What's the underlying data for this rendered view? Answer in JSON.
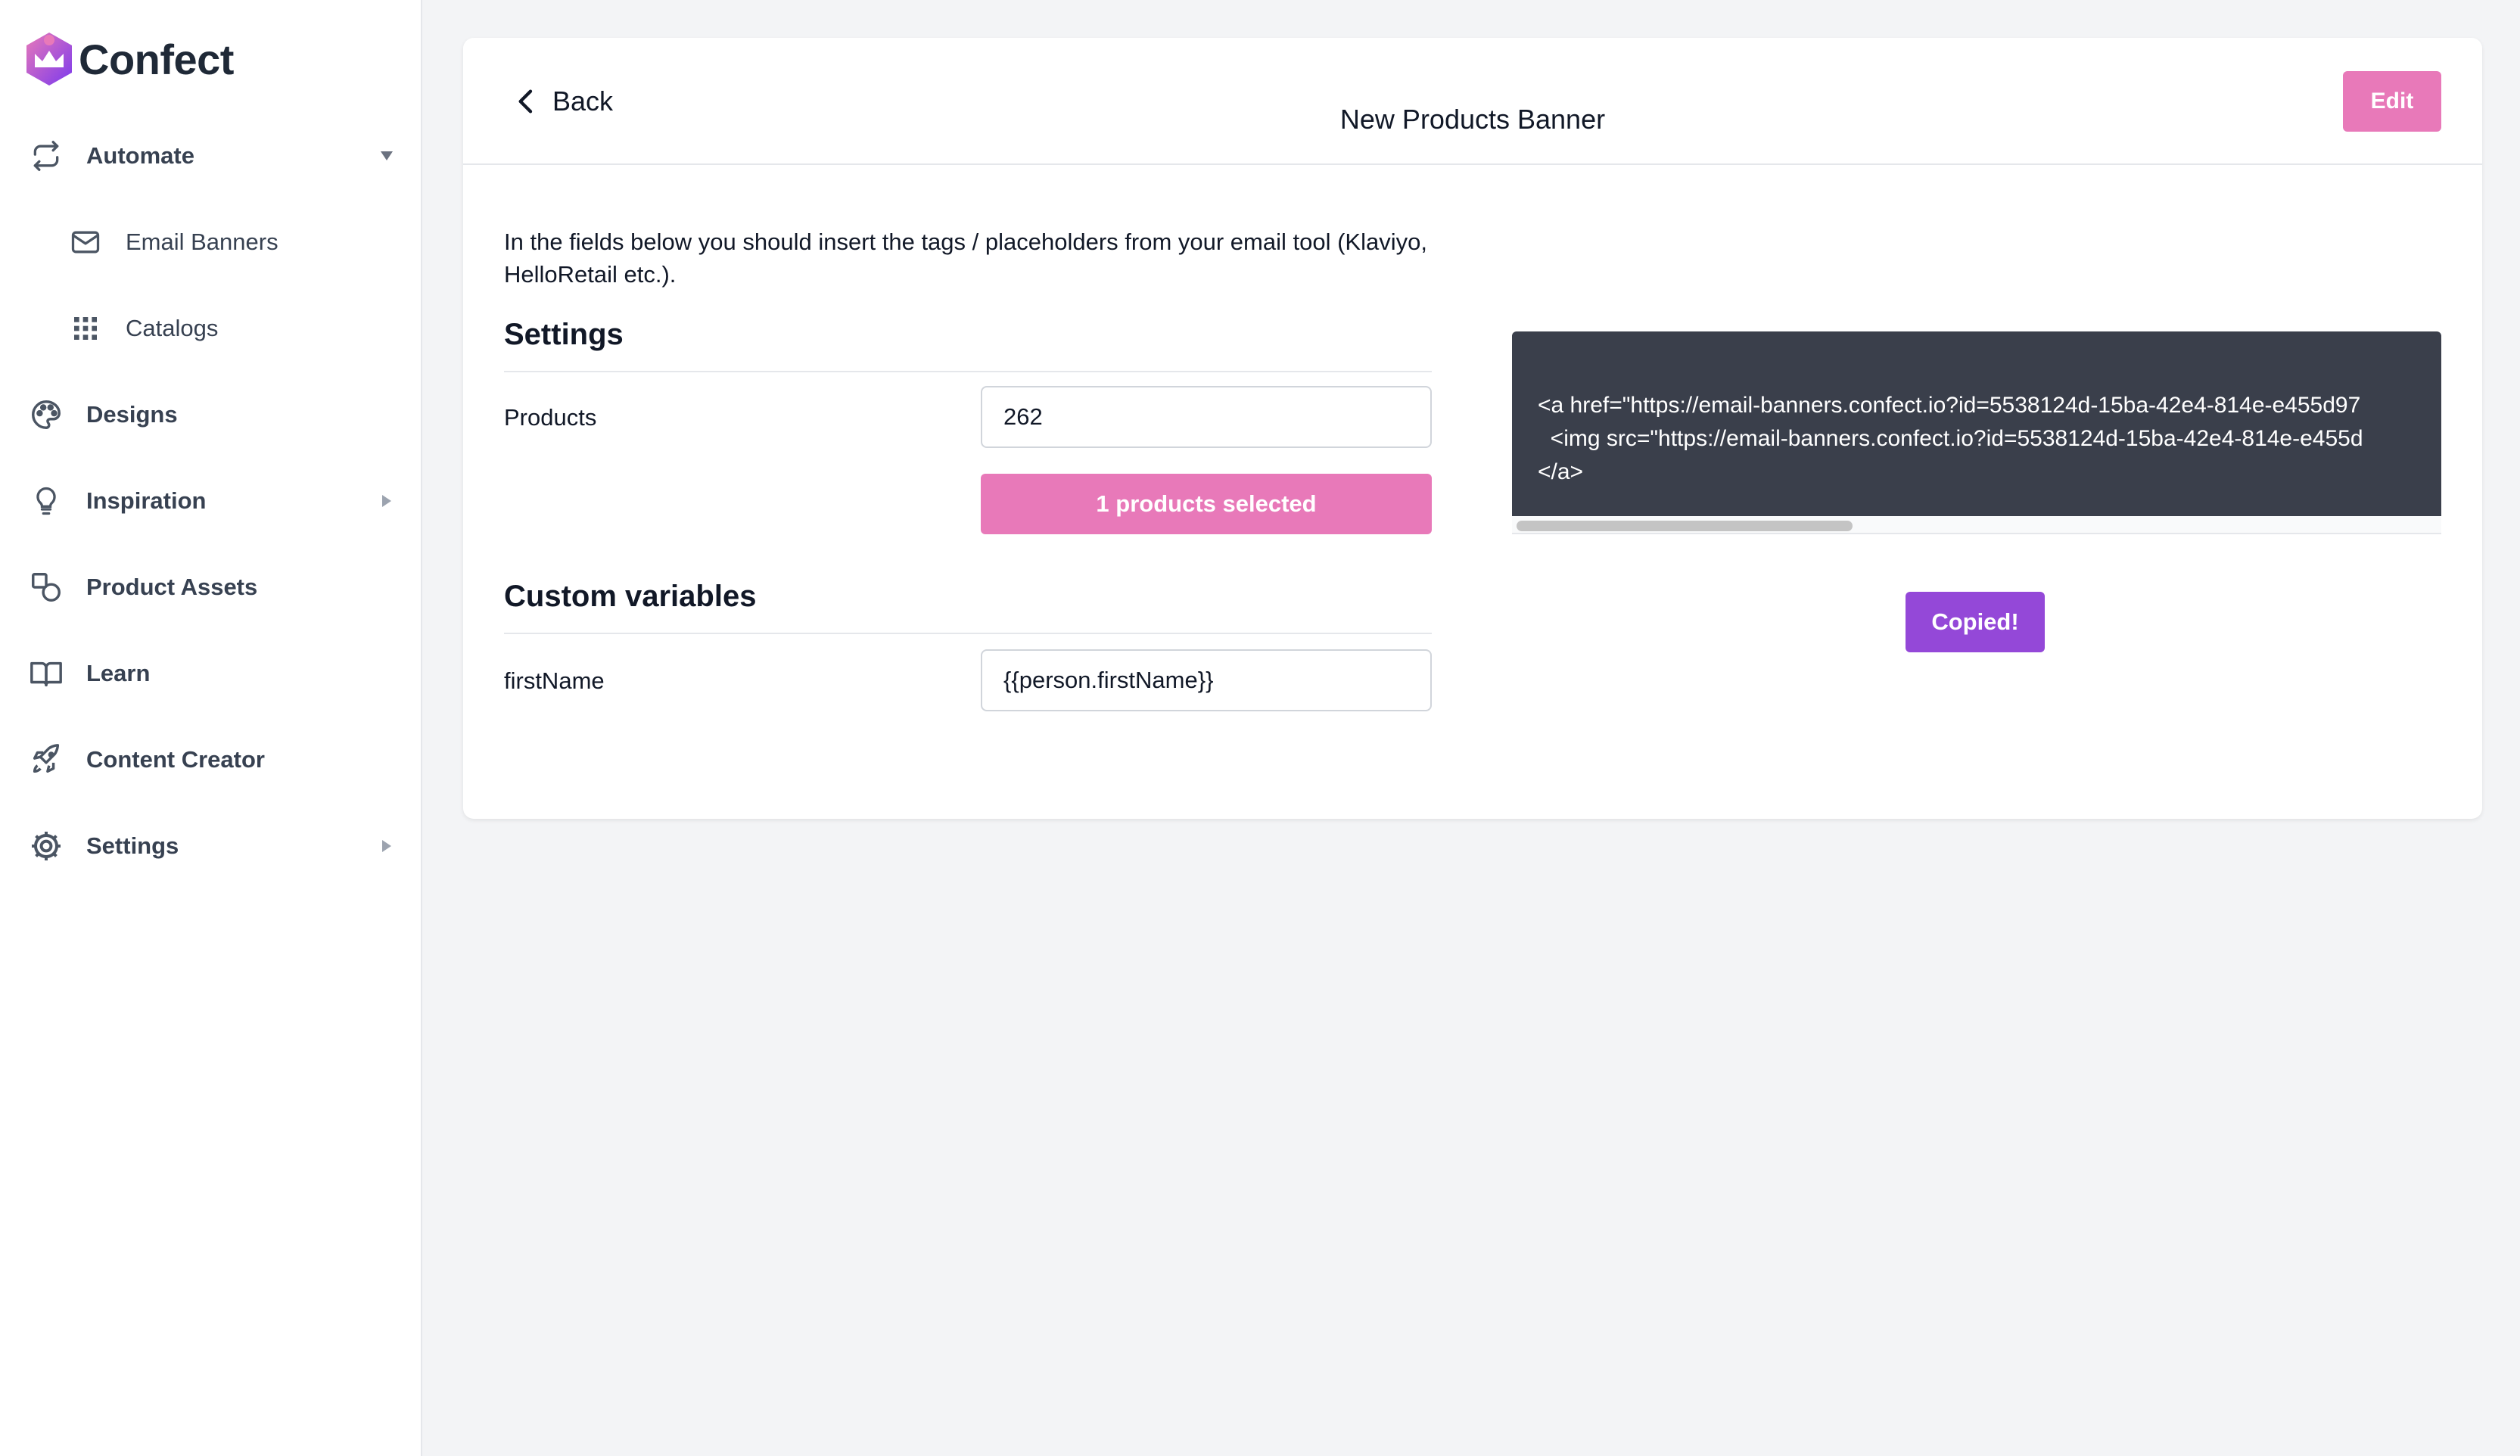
{
  "brand": {
    "name": "Confect"
  },
  "sidebar": {
    "items": [
      {
        "label": "Automate",
        "icon": "repeat-icon",
        "caret": "down"
      },
      {
        "label": "Email Banners",
        "icon": "envelope-icon",
        "sub": true
      },
      {
        "label": "Catalogs",
        "icon": "grid-icon",
        "sub": true
      },
      {
        "label": "Designs",
        "icon": "palette-icon"
      },
      {
        "label": "Inspiration",
        "icon": "lightbulb-icon",
        "caret": "right"
      },
      {
        "label": "Product Assets",
        "icon": "shapes-icon"
      },
      {
        "label": "Learn",
        "icon": "book-icon"
      },
      {
        "label": "Content Creator",
        "icon": "rocket-icon"
      },
      {
        "label": "Settings",
        "icon": "gear-icon",
        "caret": "right"
      }
    ]
  },
  "header": {
    "back_label": "Back",
    "title": "New Products Banner",
    "edit_label": "Edit"
  },
  "main": {
    "intro": "In the fields below you should insert the tags / placeholders from your email tool (Klaviyo, HelloRetail etc.).",
    "settings_title": "Settings",
    "products_label": "Products",
    "products_value": "262",
    "products_selected_label": "1 products selected",
    "custom_vars_title": "Custom variables",
    "firstname_label": "firstName",
    "firstname_value": "{{person.firstName}}"
  },
  "code": {
    "line1": "<a href=\"https://email-banners.confect.io?id=5538124d-15ba-42e4-814e-e455d97",
    "line2": "  <img src=\"https://email-banners.confect.io?id=5538124d-15ba-42e4-814e-e455d",
    "line3": "</a>",
    "copied_label": "Copied!"
  },
  "colors": {
    "pink_accent": "#e879b9",
    "purple_accent": "#9448d8",
    "code_background": "#3a3f4b",
    "page_background": "#f3f4f6"
  }
}
